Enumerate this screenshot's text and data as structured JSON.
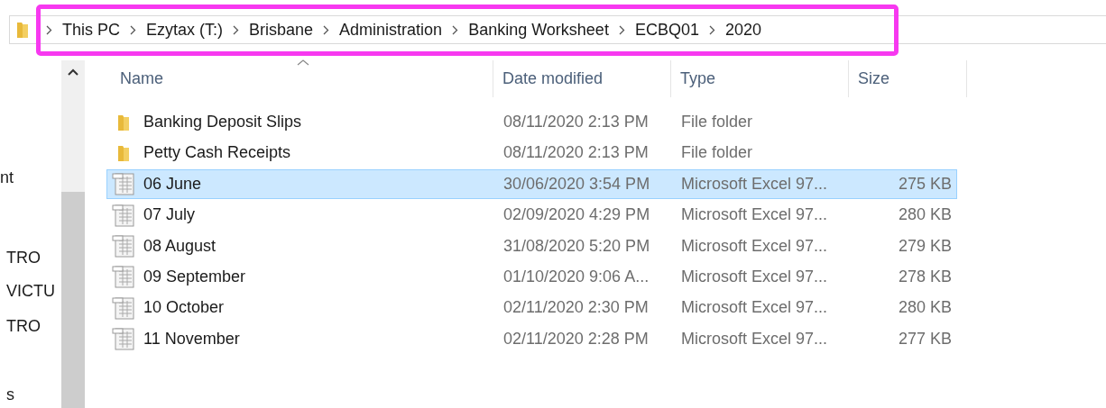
{
  "address_bar": {
    "crumbs": [
      "This PC",
      "Ezytax (T:)",
      "Brisbane",
      "Administration",
      "Banking Worksheet",
      "ECBQ01",
      "2020"
    ],
    "highlighted": true
  },
  "nav_pane": {
    "items": [
      {
        "label": "nt"
      },
      {
        "label": "TRO"
      },
      {
        "label": "VICTU"
      },
      {
        "label": "TRO"
      },
      {
        "label": "s"
      }
    ]
  },
  "table": {
    "columns": [
      {
        "label": "Name",
        "sorted": true
      },
      {
        "label": "Date modified",
        "sorted": false
      },
      {
        "label": "Type",
        "sorted": false
      },
      {
        "label": "Size",
        "sorted": false
      }
    ],
    "rows": [
      {
        "kind": "folder",
        "name": "Banking Deposit Slips",
        "date": "08/11/2020 2:13 PM",
        "type": "File folder",
        "selected": false
      },
      {
        "kind": "folder",
        "name": "Petty Cash Receipts",
        "date": "08/11/2020 2:13 PM",
        "type": "File folder",
        "selected": false
      },
      {
        "kind": "sheet",
        "name": "06 June",
        "date": "30/06/2020 3:54 PM",
        "type": "Microsoft Excel 97...",
        "size": "275 KB",
        "selected": true
      },
      {
        "kind": "sheet",
        "name": "07 July",
        "date": "02/09/2020 4:29 PM",
        "type": "Microsoft Excel 97...",
        "size": "280 KB",
        "selected": false
      },
      {
        "kind": "sheet",
        "name": "08 August",
        "date": "31/08/2020 5:20 PM",
        "type": "Microsoft Excel 97...",
        "size": "279 KB",
        "selected": false
      },
      {
        "kind": "sheet",
        "name": "09 September",
        "date": "01/10/2020 9:06 A...",
        "type": "Microsoft Excel 97...",
        "size": "278 KB",
        "selected": false
      },
      {
        "kind": "sheet",
        "name": "10 October",
        "date": "02/11/2020 2:30 PM",
        "type": "Microsoft Excel 97...",
        "size": "280 KB",
        "selected": false
      },
      {
        "kind": "sheet",
        "name": "11 November",
        "date": "02/11/2020 2:28 PM",
        "type": "Microsoft Excel 97...",
        "size": "277 KB",
        "selected": false
      }
    ]
  }
}
